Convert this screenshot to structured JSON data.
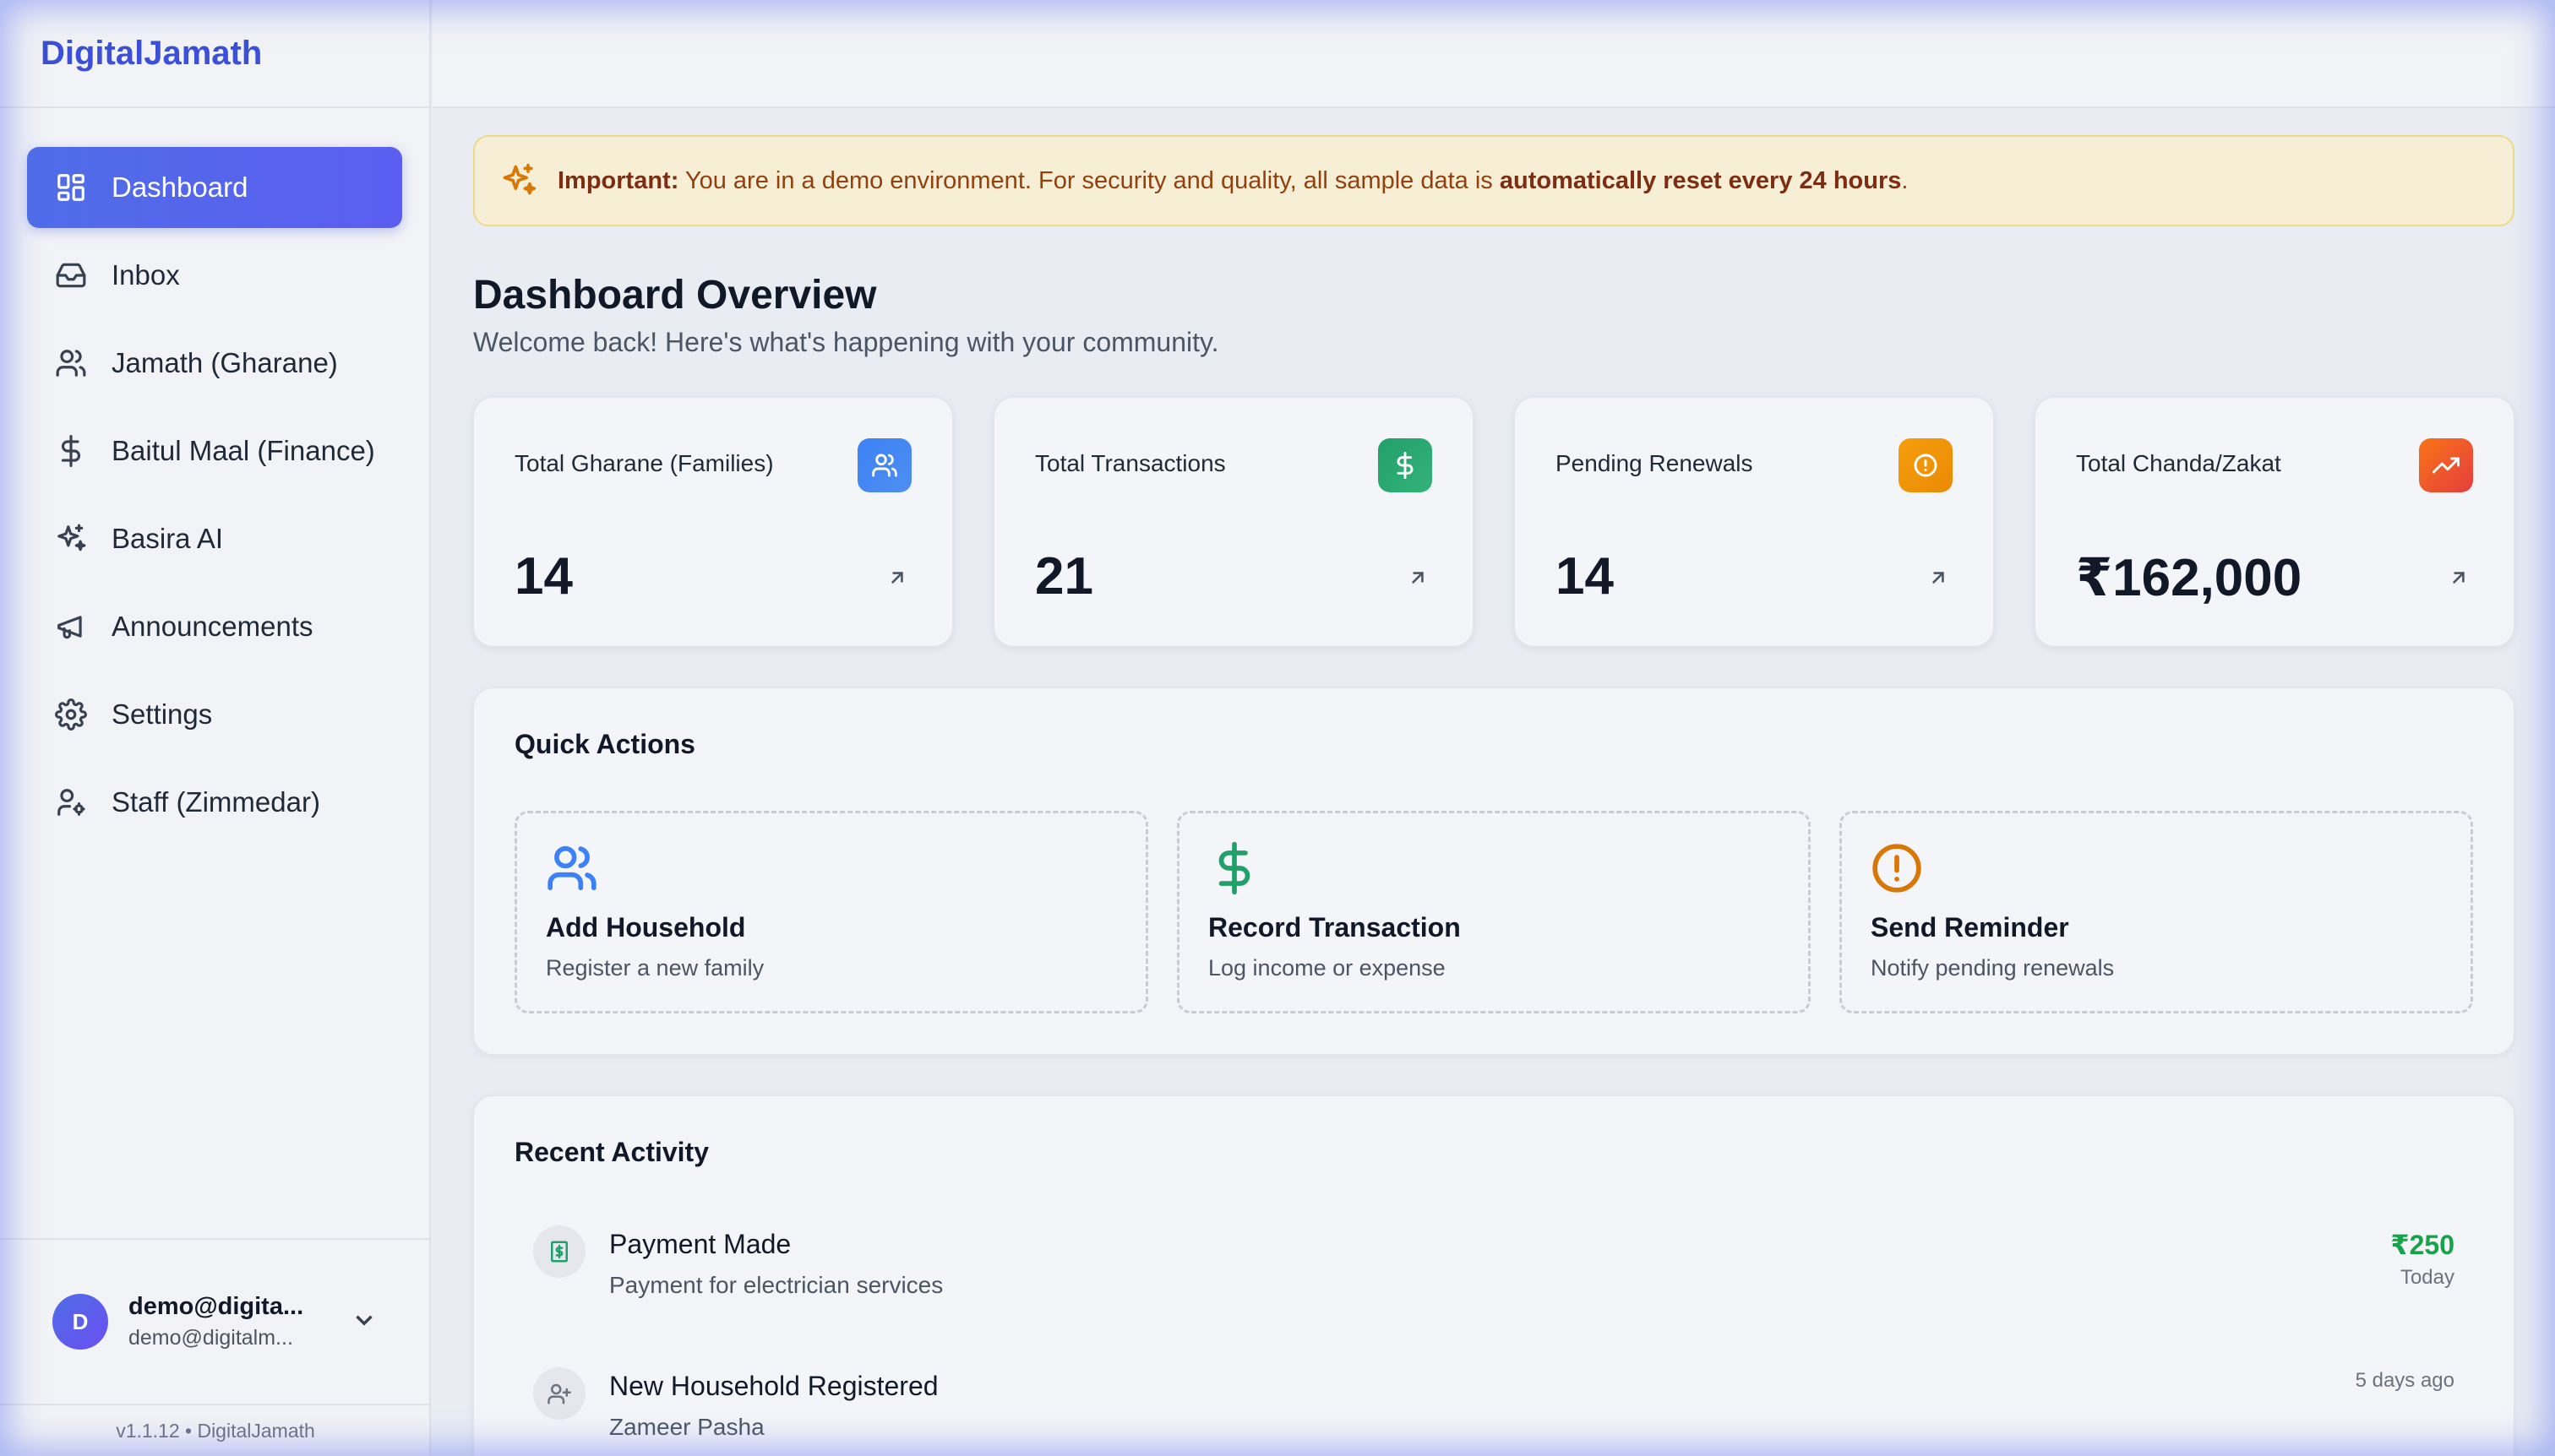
{
  "brand": "DigitalJamath",
  "nav": [
    {
      "label": "Dashboard",
      "icon": "dashboard-icon",
      "active": true
    },
    {
      "label": "Inbox",
      "icon": "inbox-icon"
    },
    {
      "label": "Jamath (Gharane)",
      "icon": "users-icon"
    },
    {
      "label": "Baitul Maal (Finance)",
      "icon": "dollar-icon"
    },
    {
      "label": "Basira AI",
      "icon": "sparkles-icon"
    },
    {
      "label": "Announcements",
      "icon": "megaphone-icon"
    },
    {
      "label": "Settings",
      "icon": "gear-icon"
    },
    {
      "label": "Staff (Zimmedar)",
      "icon": "user-cog-icon"
    }
  ],
  "user": {
    "initial": "D",
    "name": "demo@digita...",
    "email": "demo@digitalm..."
  },
  "version": "v1.1.12 • DigitalJamath",
  "banner": {
    "prefix": "Important:",
    "text": " You are in a demo environment. For security and quality, all sample data is ",
    "emphasis": "automatically reset every 24 hours",
    "suffix": "."
  },
  "page": {
    "title": "Dashboard Overview",
    "subtitle": "Welcome back! Here's what's happening with your community."
  },
  "stats": [
    {
      "label": "Total Gharane (Families)",
      "value": "14",
      "icon": "users-icon",
      "color": "#3b82f6"
    },
    {
      "label": "Total Transactions",
      "value": "21",
      "icon": "dollar-icon",
      "color": "#22a06b"
    },
    {
      "label": "Pending Renewals",
      "value": "14",
      "icon": "alert-icon",
      "color": "#f59e0b"
    },
    {
      "label": "Total Chanda/Zakat",
      "value": "₹162,000",
      "icon": "trending-up-icon",
      "color": "#ef4444"
    }
  ],
  "quick_actions": {
    "title": "Quick Actions",
    "items": [
      {
        "title": "Add Household",
        "desc": "Register a new family",
        "icon": "users-icon",
        "color": "#3b82f6"
      },
      {
        "title": "Record Transaction",
        "desc": "Log income or expense",
        "icon": "dollar-icon",
        "color": "#22a06b"
      },
      {
        "title": "Send Reminder",
        "desc": "Notify pending renewals",
        "icon": "alert-icon",
        "color": "#d97706"
      }
    ]
  },
  "recent_activity": {
    "title": "Recent Activity",
    "items": [
      {
        "title": "Payment Made",
        "sub": "Payment for electrician services",
        "amount": "₹250",
        "time": "Today",
        "icon": "receipt-icon"
      },
      {
        "title": "New Household Registered",
        "sub": "Zameer Pasha",
        "amount": "",
        "time": "5 days ago",
        "icon": "user-plus-icon"
      }
    ]
  }
}
